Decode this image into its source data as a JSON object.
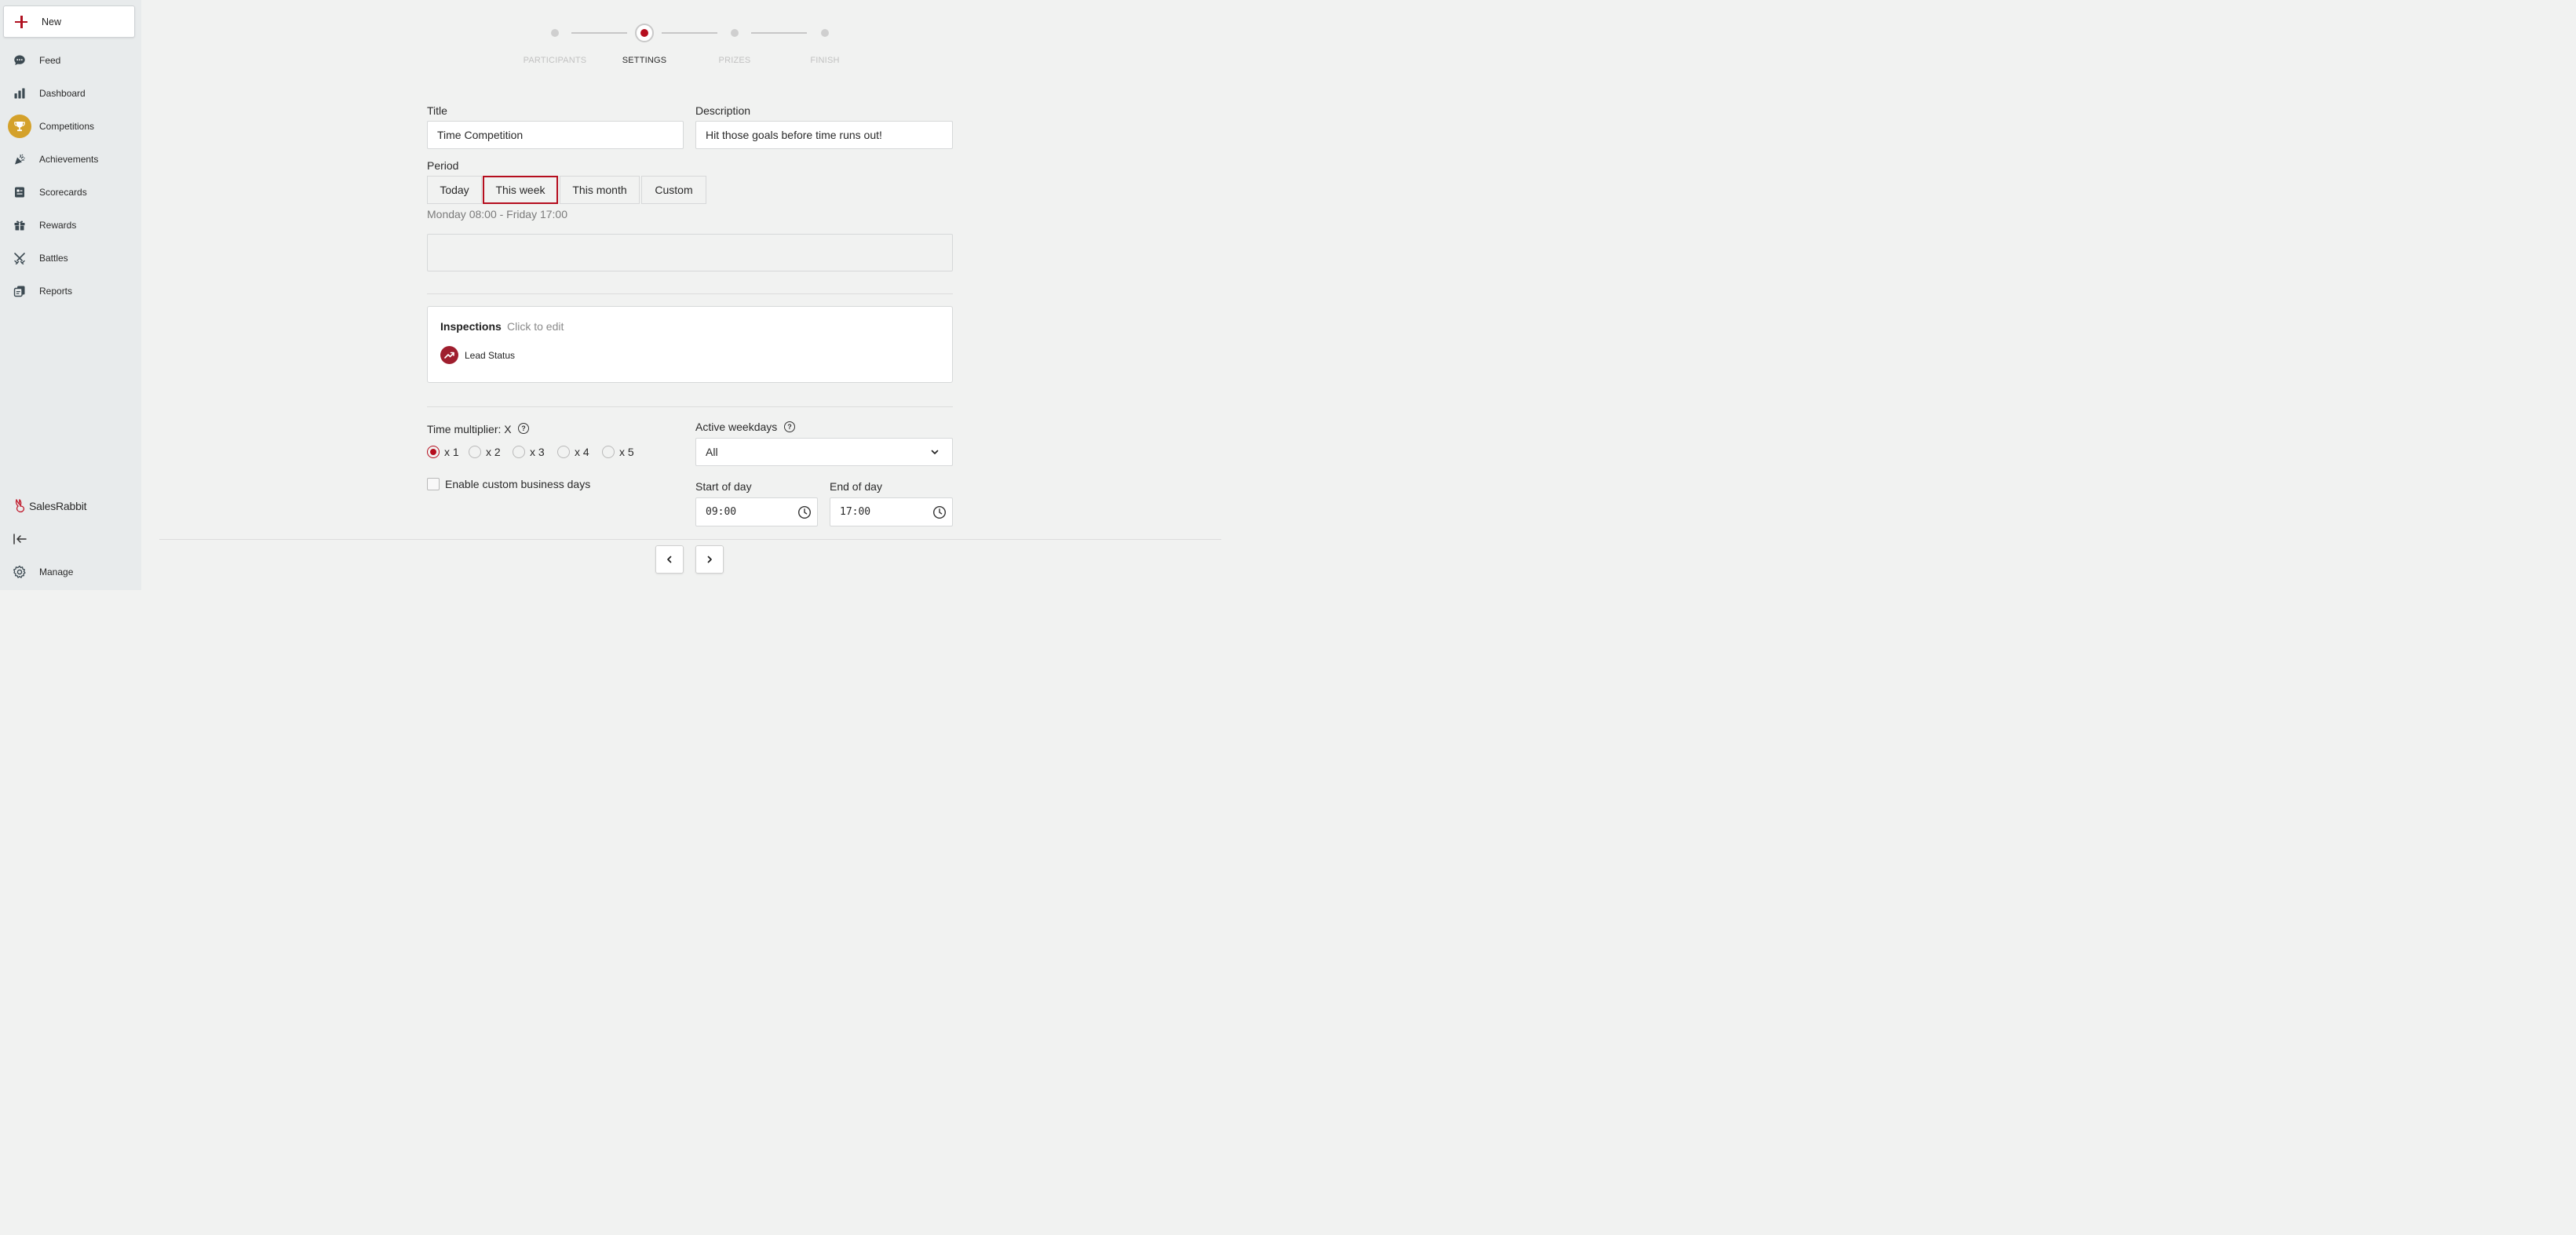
{
  "sidebar": {
    "new_label": "New",
    "items": [
      {
        "label": "Feed",
        "icon": "chat-bubble-icon"
      },
      {
        "label": "Dashboard",
        "icon": "bar-chart-icon"
      },
      {
        "label": "Competitions",
        "icon": "trophy-icon",
        "active": true
      },
      {
        "label": "Achievements",
        "icon": "party-popper-icon"
      },
      {
        "label": "Scorecards",
        "icon": "scorecard-icon"
      },
      {
        "label": "Rewards",
        "icon": "gift-icon"
      },
      {
        "label": "Battles",
        "icon": "crossed-swords-icon"
      },
      {
        "label": "Reports",
        "icon": "report-icon"
      }
    ],
    "brand": "SalesRabbit",
    "manage_label": "Manage"
  },
  "stepper": {
    "steps": [
      {
        "label": "PARTICIPANTS"
      },
      {
        "label": "SETTINGS",
        "current": true
      },
      {
        "label": "PRIZES"
      },
      {
        "label": "FINISH"
      }
    ]
  },
  "form": {
    "title_label": "Title",
    "title_value": "Time Competition",
    "description_label": "Description",
    "description_value": "Hit those goals before time runs out!",
    "period_label": "Period",
    "period_options": [
      "Today",
      "This week",
      "This month",
      "Custom"
    ],
    "period_selected": "This week",
    "period_range": "Monday 08:00 - Friday 17:00",
    "inspections": {
      "title": "Inspections",
      "hint": "Click to edit",
      "metric": "Lead Status"
    },
    "time_multiplier_label": "Time multiplier: X",
    "multipliers": [
      "x 1",
      "x 2",
      "x 3",
      "x 4",
      "x 5"
    ],
    "multiplier_selected": "x 1",
    "custom_business_days_label": "Enable custom business days",
    "active_weekdays_label": "Active weekdays",
    "active_weekdays_value": "All",
    "start_of_day_label": "Start of day",
    "start_of_day_value": "09:00",
    "end_of_day_label": "End of day",
    "end_of_day_value": "17:00"
  },
  "colors": {
    "accent": "#b50e1e",
    "active_nav": "#d4a12a",
    "metric_icon_bg": "#9f1e2e"
  }
}
